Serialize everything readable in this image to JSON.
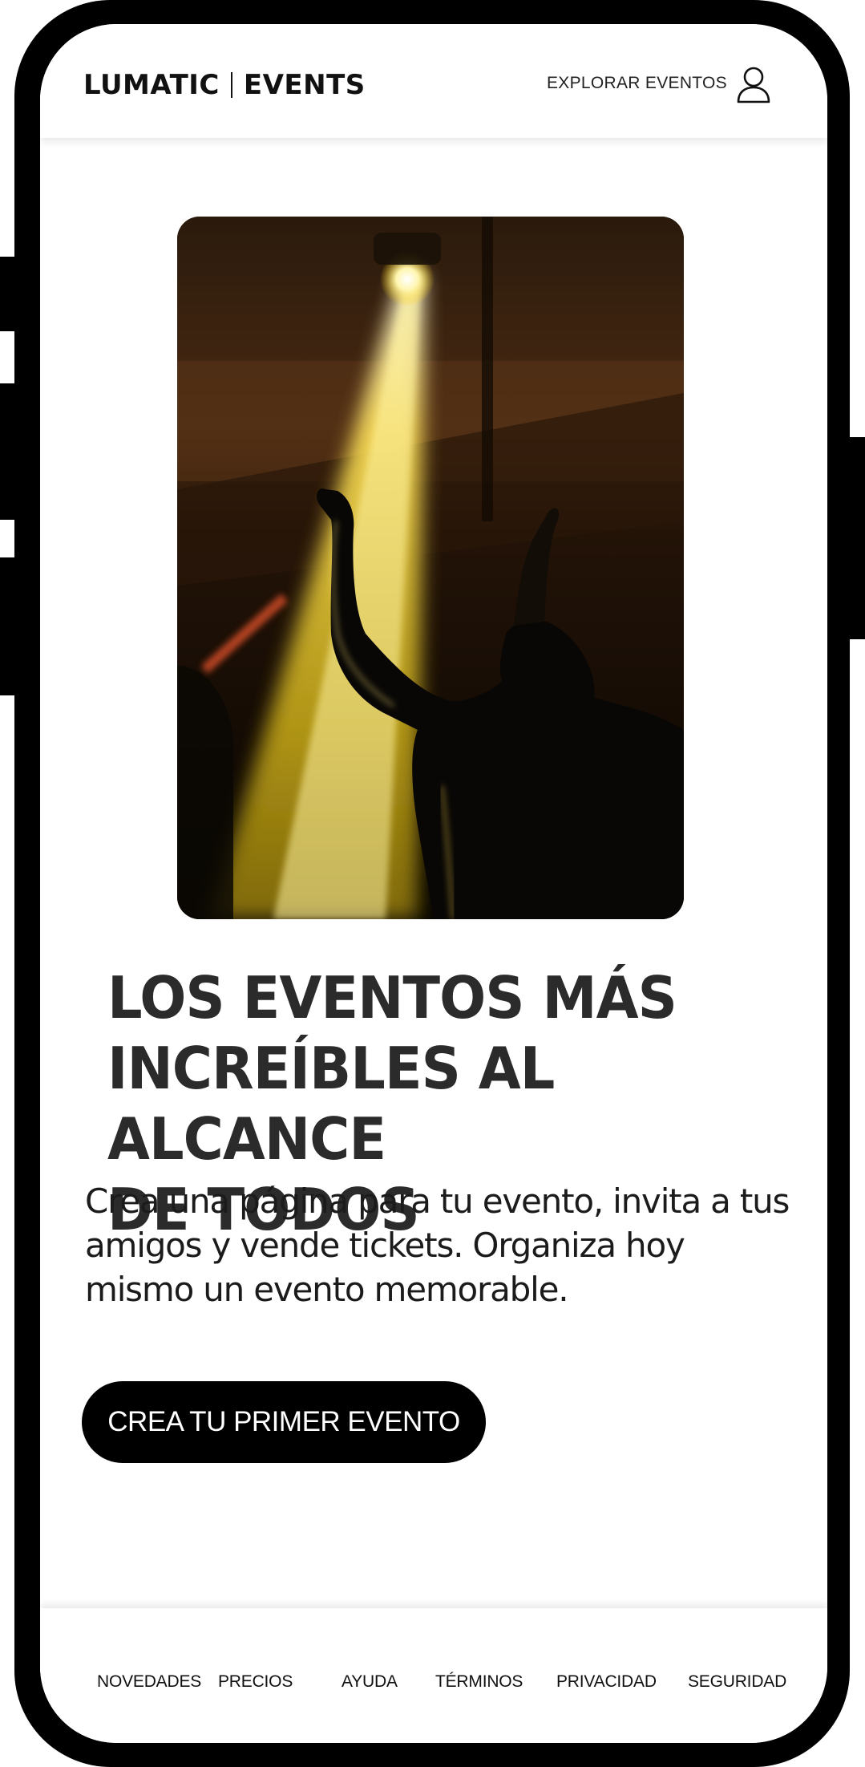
{
  "header": {
    "brand_left": "LUMATIC",
    "brand_right": "EVENTS",
    "nav_link": "EXPLORAR EVENTOS",
    "account_icon": "user-icon"
  },
  "hero": {
    "image_icon": "concert-photo",
    "headline_lines": [
      "LOS EVENTOS MÁS",
      "INCREÍBLES AL ALCANCE",
      "DE TODOS"
    ],
    "subtext_lines": [
      "Crea una página para tu evento, invita a tus",
      "amigos y vende tickets. Organiza hoy",
      "mismo un evento memorable."
    ],
    "cta_label": "CREA TU PRIMER EVENTO"
  },
  "footer": {
    "links": [
      "NOVEDADES",
      "PRECIOS",
      "AYUDA",
      "TÉRMINOS",
      "PRIVACIDAD",
      "SEGURIDAD"
    ]
  },
  "colors": {
    "frame": "#000000",
    "background": "#ffffff",
    "headline": "#2b2b2b",
    "button": "#000000",
    "button_text": "#ffffff"
  }
}
